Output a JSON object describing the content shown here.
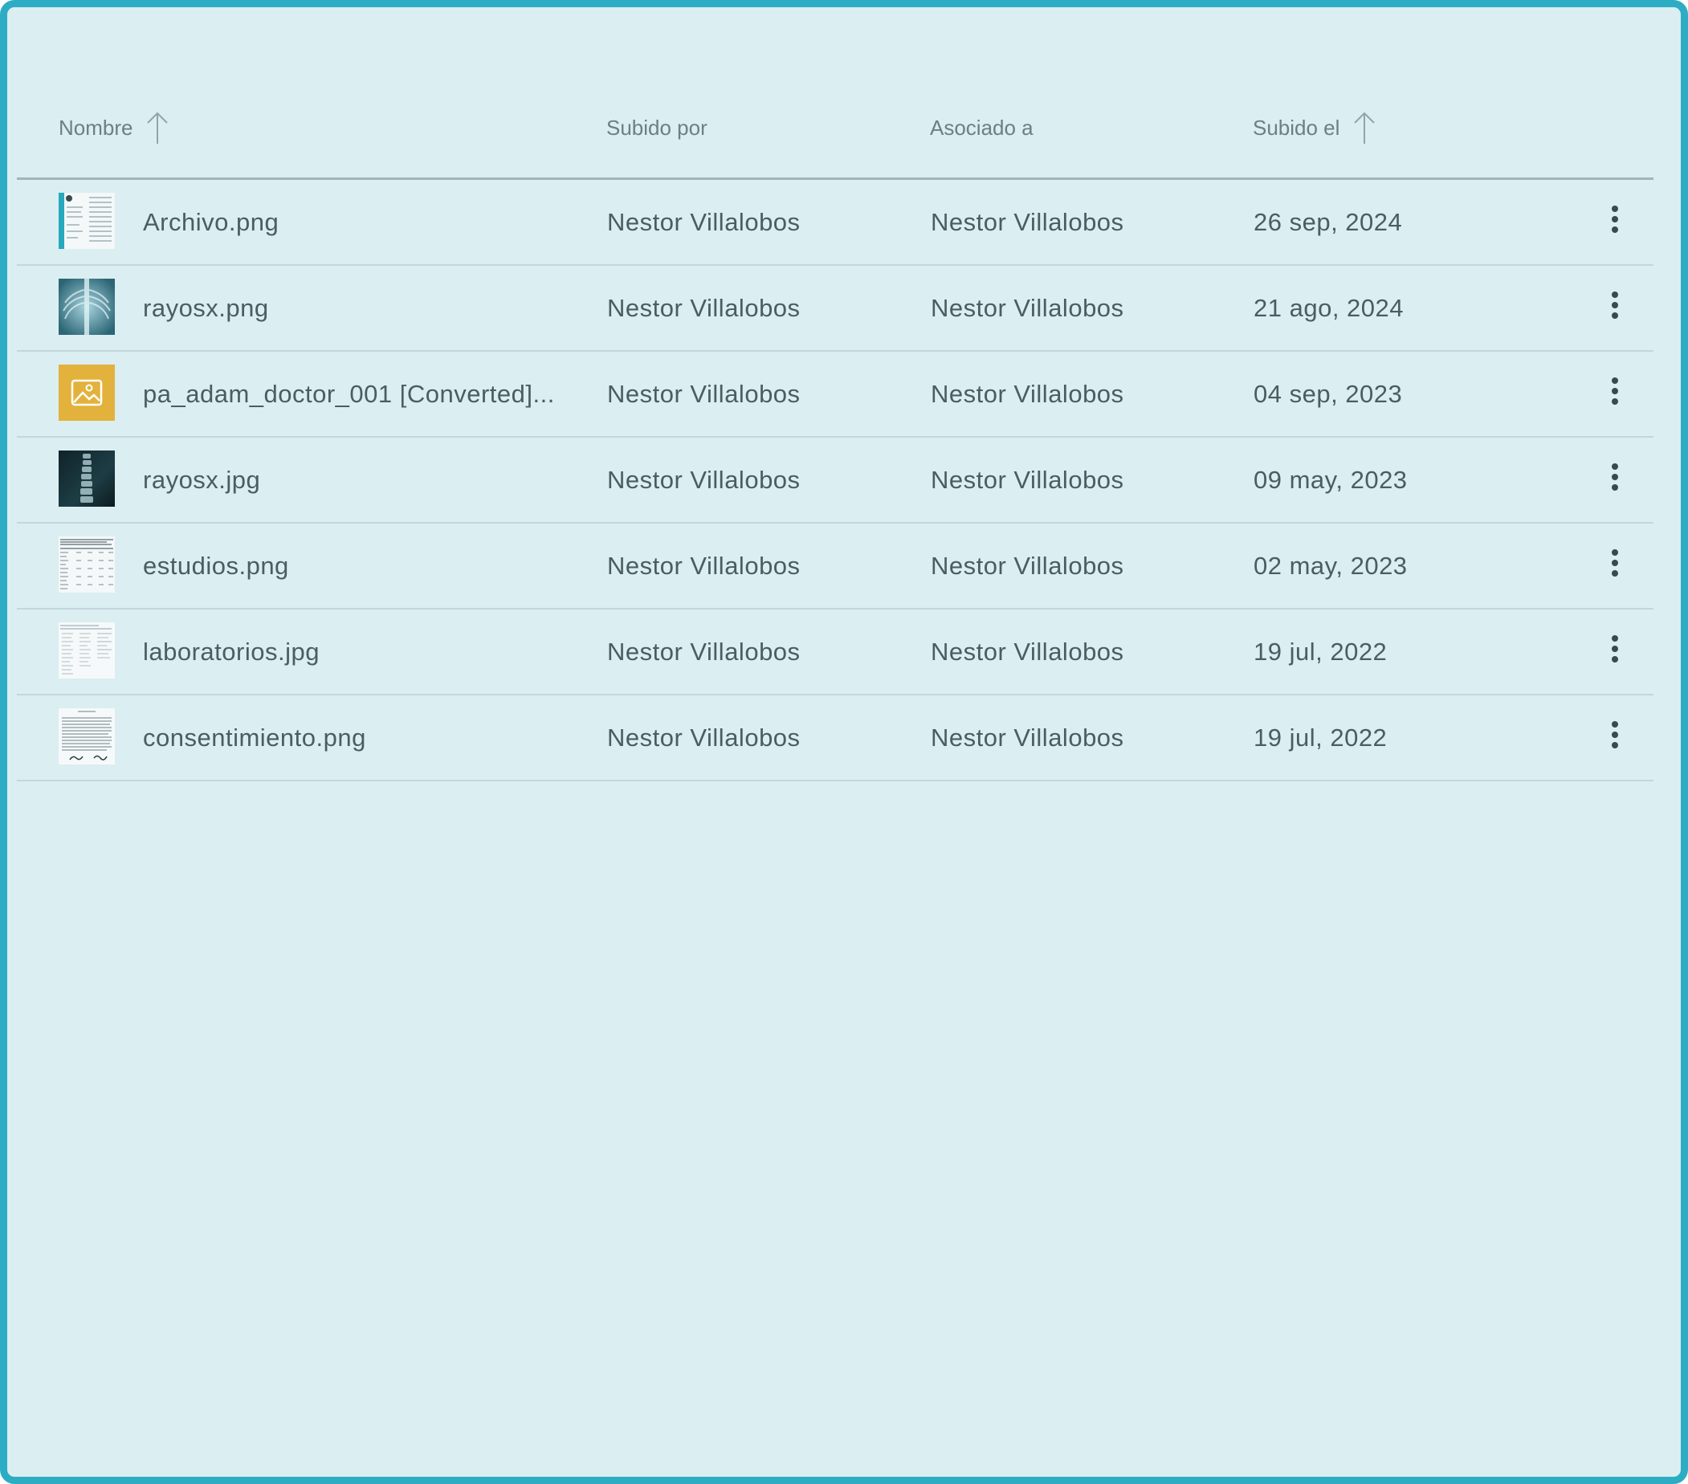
{
  "table": {
    "columns": {
      "name": "Nombre",
      "uploaded_by": "Subido por",
      "associated_to": "Asociado a",
      "uploaded_on": "Subido el"
    },
    "sort_icon": "arrow-up-icon",
    "rows": [
      {
        "name": "Archivo.png",
        "uploaded_by": "Nestor Villalobos",
        "associated_to": "Nestor Villalobos",
        "uploaded_on": "26 sep, 2024",
        "thumbnail": "document-thumbnail"
      },
      {
        "name": "rayosx.png",
        "uploaded_by": "Nestor Villalobos",
        "associated_to": "Nestor Villalobos",
        "uploaded_on": "21 ago, 2024",
        "thumbnail": "xray-chest-thumbnail"
      },
      {
        "name": "pa_adam_doctor_001 [Converted]...",
        "uploaded_by": "Nestor Villalobos",
        "associated_to": "Nestor Villalobos",
        "uploaded_on": "04 sep, 2023",
        "thumbnail": "image-placeholder-icon"
      },
      {
        "name": "rayosx.jpg",
        "uploaded_by": "Nestor Villalobos",
        "associated_to": "Nestor Villalobos",
        "uploaded_on": "09 may, 2023",
        "thumbnail": "xray-spine-thumbnail"
      },
      {
        "name": "estudios.png",
        "uploaded_by": "Nestor Villalobos",
        "associated_to": "Nestor Villalobos",
        "uploaded_on": "02 may, 2023",
        "thumbnail": "table-document-thumbnail"
      },
      {
        "name": "laboratorios.jpg",
        "uploaded_by": "Nestor Villalobos",
        "associated_to": "Nestor Villalobos",
        "uploaded_on": "19 jul, 2022",
        "thumbnail": "lab-document-thumbnail"
      },
      {
        "name": "consentimiento.png",
        "uploaded_by": "Nestor Villalobos",
        "associated_to": "Nestor Villalobos",
        "uploaded_on": "19 jul, 2022",
        "thumbnail": "text-document-thumbnail"
      }
    ]
  },
  "colors": {
    "frame_border": "#2cadc3",
    "background": "#dbeef1",
    "placeholder_yellow": "#e2b23c"
  }
}
